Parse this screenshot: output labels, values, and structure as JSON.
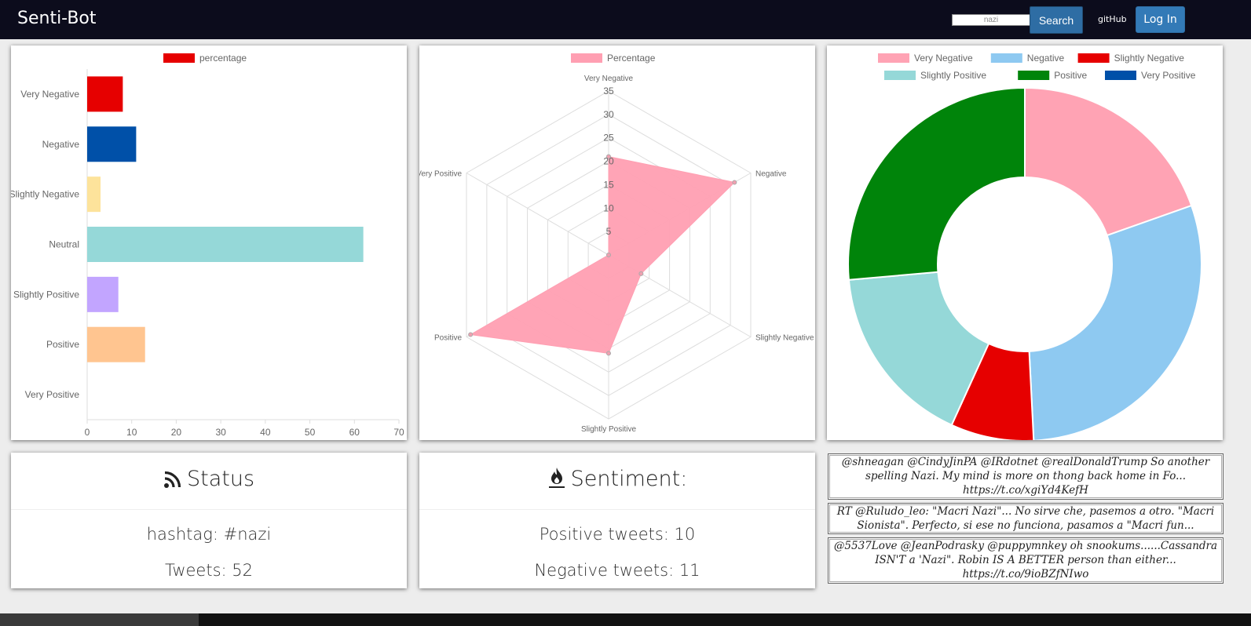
{
  "navbar": {
    "brand": "Senti-Bot",
    "search_value": "nazi",
    "search_label": "Search",
    "github_label": "gitHub",
    "login_label": "Log In"
  },
  "chart_data": [
    {
      "type": "bar",
      "orientation": "horizontal",
      "legend": [
        "percentage"
      ],
      "categories": [
        "Very Negative",
        "Negative",
        "Slightly Negative",
        "Neutral",
        "Slightly Positive",
        "Positive",
        "Very Positive"
      ],
      "values": [
        8,
        11,
        3,
        62,
        7,
        13,
        0
      ],
      "colors": [
        "#e60000",
        "#0050a8",
        "#fde39b",
        "#95d8d8",
        "#c2a5ff",
        "#ffc590",
        "#ffffff"
      ],
      "xlim": [
        0,
        70
      ],
      "xticks": [
        "0",
        "10",
        "20",
        "30",
        "40",
        "50",
        "60",
        "70"
      ]
    },
    {
      "type": "radar",
      "legend": [
        "Percentage"
      ],
      "axes": [
        "Very Negative",
        "Negative",
        "Slightly Negative",
        "Slightly Positive",
        "Positive",
        "Very Positive"
      ],
      "values": [
        21,
        31,
        8,
        21,
        34,
        0
      ],
      "rlim": [
        0,
        35
      ],
      "rticks": [
        "5",
        "10",
        "15",
        "20",
        "25",
        "30",
        "35"
      ],
      "fill_color": "#ff9fb2"
    },
    {
      "type": "pie",
      "legend": [
        "Very Negative",
        "Negative",
        "Slightly Negative",
        "Slightly Positive",
        "Positive",
        "Very Positive"
      ],
      "colors": [
        "#ffa3b4",
        "#8ec9f1",
        "#e60000",
        "#95d8d8",
        "#00840a",
        "#0050a8"
      ],
      "values": [
        19.6,
        29.6,
        7.6,
        16.8,
        26.4,
        0
      ]
    }
  ],
  "status": {
    "title": "Status",
    "hashtag": "hashtag: #nazi",
    "tweets": "Tweets: 52"
  },
  "sentiment": {
    "title": "Sentiment:",
    "positive": "Positive tweets: 10",
    "negative": "Negative tweets: 11"
  },
  "tweets": [
    "@shneagan @CindyJinPA @IRdotnet @realDonaldTrump So another spelling Nazi. My mind is more on thong back home in Fo... https://t.co/xgiYd4KefH",
    "RT @Ruludo_leo: \"Macri Nazi\"... No sirve che, pasemos a otro. \"Macri Sionista\". Perfecto, si ese no funciona, pasamos a \"Macri fun...",
    "@5537Love @JeanPodrasky @puppymnkey oh snookums......Cassandra ISN'T a 'Nazi\". Robin IS A BETTER person than either... https://t.co/9ioBZfNIwo"
  ],
  "icons": {
    "status": "rss-icon",
    "sentiment": "fire-icon"
  }
}
